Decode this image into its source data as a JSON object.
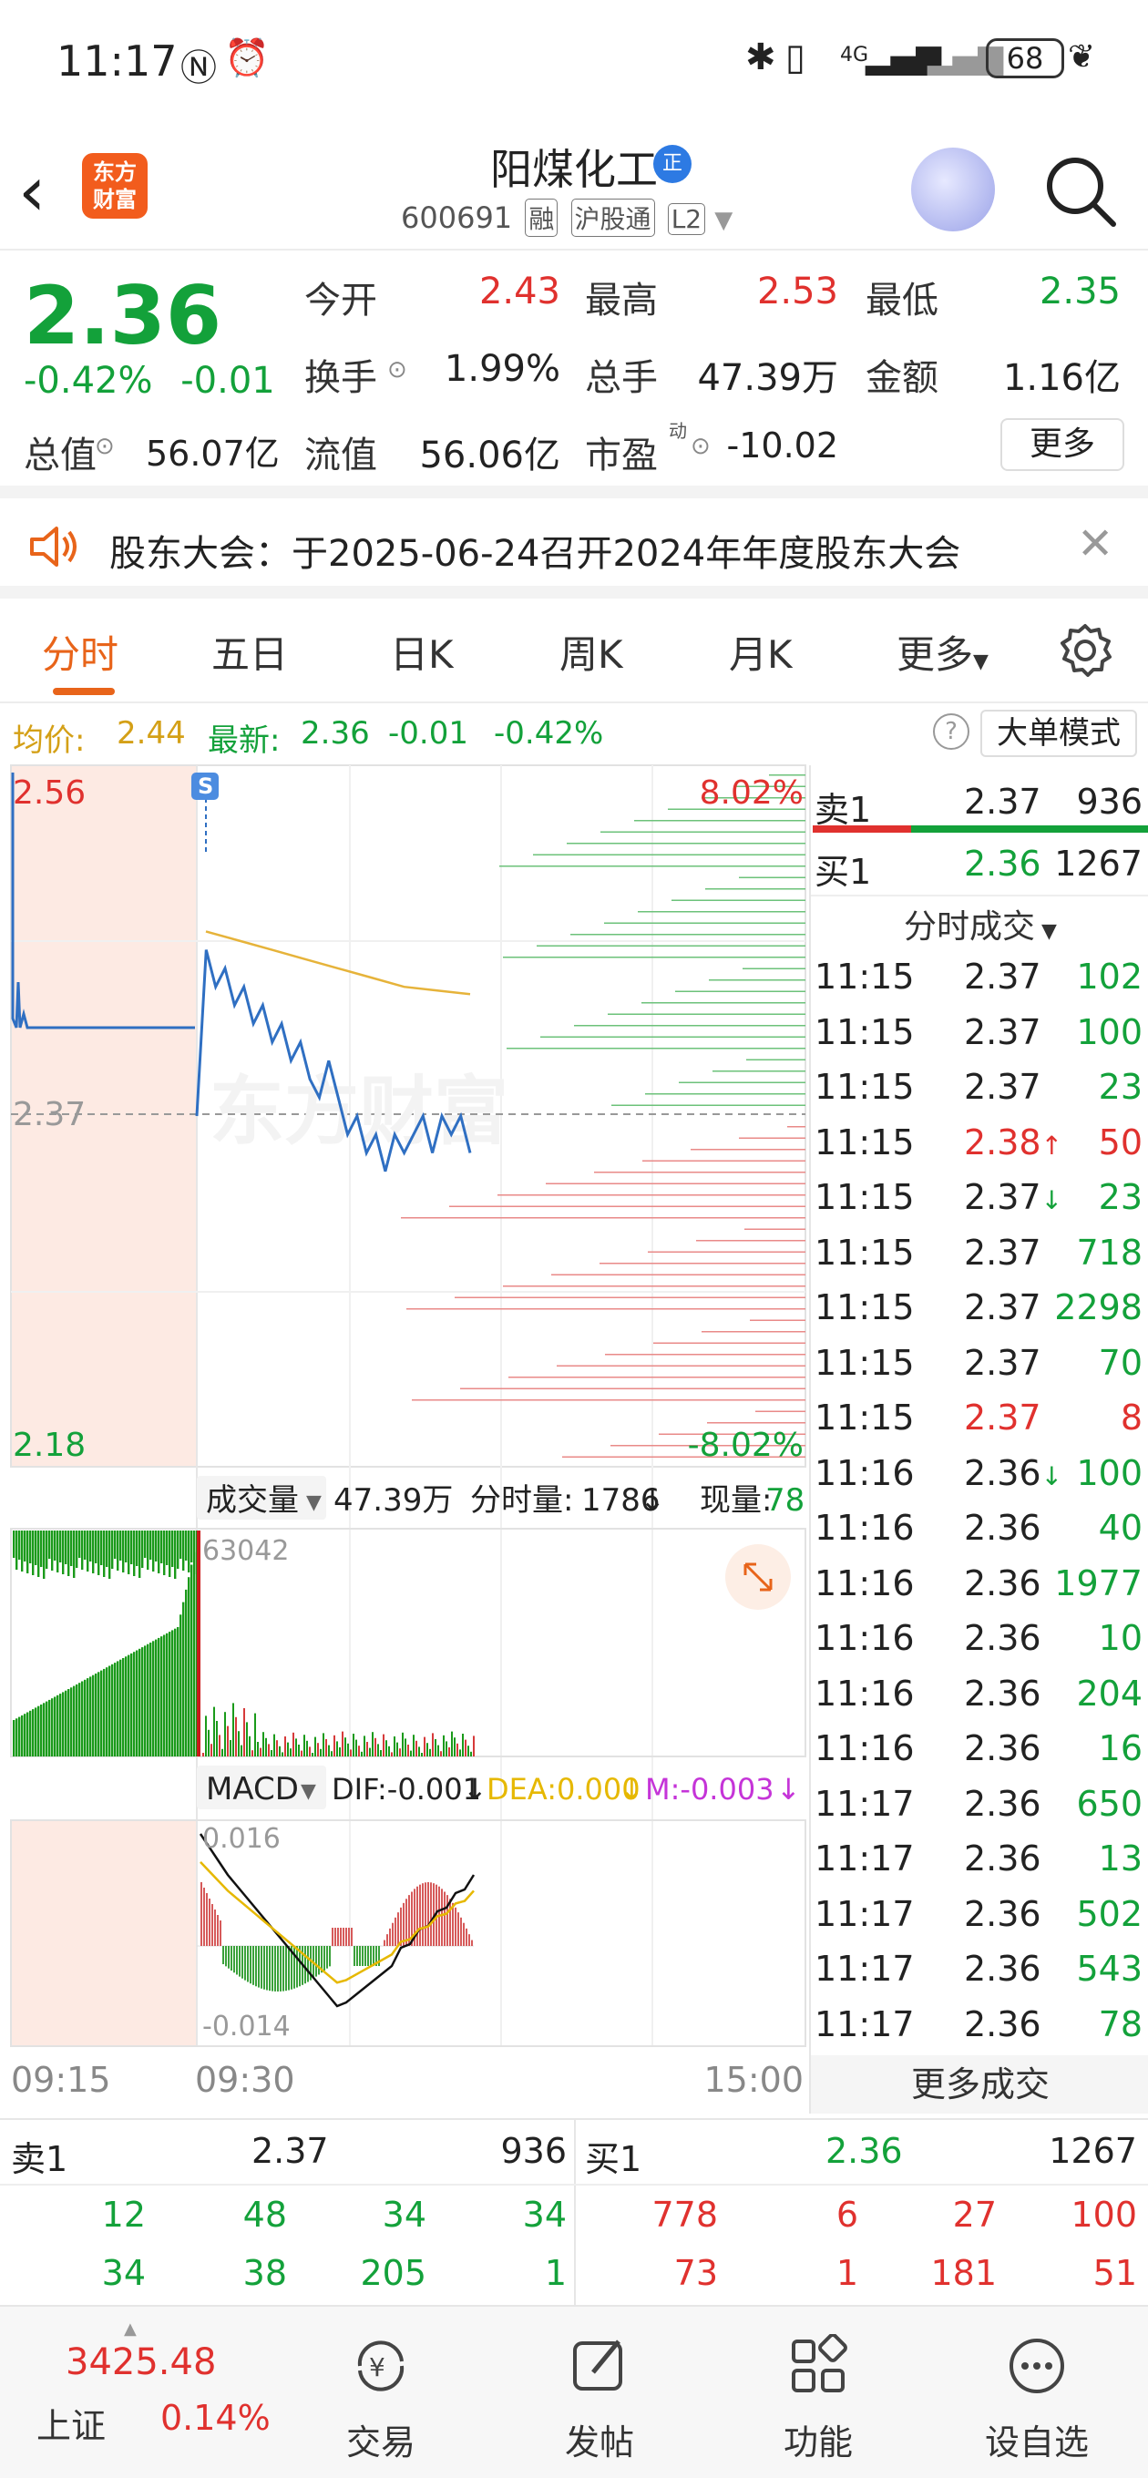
{
  "status_bar": {
    "time": "11:17",
    "battery": "68",
    "network": "4G"
  },
  "header": {
    "stock_name": "阳煤化工",
    "badge": "正",
    "stock_code": "600691",
    "tags": [
      "融",
      "沪股通",
      "L2"
    ],
    "logo_line1": "东方",
    "logo_line2": "财富"
  },
  "quote": {
    "price": "2.36",
    "change_pct": "-0.42%",
    "change_abs": "-0.01",
    "open_label": "今开",
    "open": "2.43",
    "high_label": "最高",
    "high": "2.53",
    "low_label": "最低",
    "low": "2.35",
    "turnover_label": "换手",
    "turnover": "1.99%",
    "volume_label": "总手",
    "volume": "47.39万",
    "amount_label": "金额",
    "amount": "1.16亿",
    "mktcap_label": "总值",
    "mktcap": "56.07亿",
    "float_label": "流值",
    "float_cap": "56.06亿",
    "pe_label": "市盈",
    "pe_sup": "动",
    "pe": "-10.02",
    "more": "更多"
  },
  "notice": {
    "text": "股东大会：于2025-06-24召开2024年年度股东大会"
  },
  "tabs": [
    "分时",
    "五日",
    "日K",
    "周K",
    "月K",
    "更多"
  ],
  "avg_row": {
    "avg_label": "均价:",
    "avg": "2.44",
    "latest_label": "最新:",
    "latest": "2.36",
    "chg": "-0.01",
    "chg_pct": "-0.42%",
    "mode_button": "大单模式"
  },
  "chart_data": {
    "type": "line",
    "price_axis": {
      "top": "2.56",
      "mid": "2.37",
      "bottom": "2.18",
      "top_pct": "8.02%",
      "bottom_pct": "-8.02%"
    },
    "price_series": [
      2.37,
      2.46,
      2.44,
      2.45,
      2.43,
      2.44,
      2.42,
      2.43,
      2.41,
      2.42,
      2.4,
      2.41,
      2.39,
      2.38,
      2.4,
      2.38,
      2.36,
      2.37,
      2.35,
      2.36,
      2.34,
      2.36,
      2.35,
      2.36,
      2.37,
      2.35,
      2.37,
      2.36,
      2.37,
      2.35
    ],
    "avg_series": [
      2.47,
      2.465,
      2.46,
      2.455,
      2.45,
      2.445,
      2.44,
      2.438,
      2.436
    ],
    "signal_marker": "S",
    "volume_bar": {
      "label": "成交量",
      "total": "47.39万",
      "minute_label": "分时量:",
      "minute": "1786",
      "minute_arrow": "↓",
      "current_label": "现量:",
      "current": "78",
      "max": "63042"
    },
    "macd": {
      "label": "MACD",
      "dif": "DIF:-0.001",
      "dif_arrow": "↓",
      "dea": "DEA:0.000",
      "dea_arrow": "↓",
      "m": "M:-0.003",
      "m_arrow": "↓",
      "top": "0.016",
      "bottom": "-0.014"
    },
    "time_axis": [
      "09:15",
      "09:30",
      "15:00"
    ]
  },
  "side": {
    "ask1_label": "卖1",
    "ask1_price": "2.37",
    "ask1_vol": "936",
    "bid1_label": "买1",
    "bid1_price": "2.36",
    "bid1_vol": "1267",
    "trades_header": "分时成交",
    "trades": [
      {
        "t": "11:15",
        "p": "2.37",
        "v": "102",
        "c": "green",
        "a": ""
      },
      {
        "t": "11:15",
        "p": "2.37",
        "v": "100",
        "c": "green",
        "a": ""
      },
      {
        "t": "11:15",
        "p": "2.37",
        "v": "23",
        "c": "green",
        "a": ""
      },
      {
        "t": "11:15",
        "p": "2.38",
        "v": "50",
        "c": "red",
        "a": "↑"
      },
      {
        "t": "11:15",
        "p": "2.37",
        "v": "23",
        "c": "green",
        "a": "↓"
      },
      {
        "t": "11:15",
        "p": "2.37",
        "v": "718",
        "c": "green",
        "a": ""
      },
      {
        "t": "11:15",
        "p": "2.37",
        "v": "2298",
        "c": "green",
        "a": ""
      },
      {
        "t": "11:15",
        "p": "2.37",
        "v": "70",
        "c": "green",
        "a": ""
      },
      {
        "t": "11:15",
        "p": "2.37",
        "v": "8",
        "c": "red",
        "a": ""
      },
      {
        "t": "11:16",
        "p": "2.36",
        "v": "100",
        "c": "green",
        "a": "↓"
      },
      {
        "t": "11:16",
        "p": "2.36",
        "v": "40",
        "c": "green",
        "a": ""
      },
      {
        "t": "11:16",
        "p": "2.36",
        "v": "1977",
        "c": "green",
        "a": ""
      },
      {
        "t": "11:16",
        "p": "2.36",
        "v": "10",
        "c": "green",
        "a": ""
      },
      {
        "t": "11:16",
        "p": "2.36",
        "v": "204",
        "c": "green",
        "a": ""
      },
      {
        "t": "11:16",
        "p": "2.36",
        "v": "16",
        "c": "green",
        "a": ""
      },
      {
        "t": "11:17",
        "p": "2.36",
        "v": "650",
        "c": "green",
        "a": ""
      },
      {
        "t": "11:17",
        "p": "2.36",
        "v": "13",
        "c": "green",
        "a": ""
      },
      {
        "t": "11:17",
        "p": "2.36",
        "v": "502",
        "c": "green",
        "a": ""
      },
      {
        "t": "11:17",
        "p": "2.36",
        "v": "543",
        "c": "green",
        "a": ""
      },
      {
        "t": "11:17",
        "p": "2.36",
        "v": "78",
        "c": "green",
        "a": ""
      }
    ],
    "more_trades": "更多成交"
  },
  "book": {
    "ask_label": "卖1",
    "ask_price": "2.37",
    "ask_vol": "936",
    "bid_label": "买1",
    "bid_price": "2.36",
    "bid_vol": "1267",
    "ask_row1": [
      "12",
      "48",
      "34",
      "34"
    ],
    "ask_row2": [
      "34",
      "38",
      "205",
      "1"
    ],
    "bid_row1": [
      "778",
      "6",
      "27",
      "100"
    ],
    "bid_row2": [
      "73",
      "1",
      "181",
      "51"
    ]
  },
  "bottom_nav": {
    "index_value": "3425.48",
    "index_name": "上证",
    "index_pct": "0.14%",
    "items": [
      "交易",
      "发帖",
      "功能",
      "设自选"
    ]
  },
  "watermark": "东方财富"
}
